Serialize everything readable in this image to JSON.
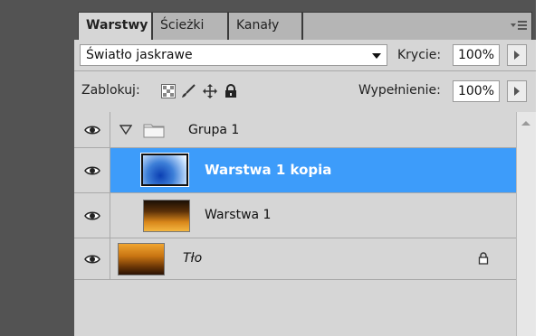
{
  "tabs": [
    {
      "label": "Warstwy",
      "active": true
    },
    {
      "label": "Ścieżki",
      "active": false
    },
    {
      "label": "Kanały",
      "active": false
    }
  ],
  "blend": {
    "mode": "Światło jaskrawe",
    "opacity_label": "Krycie:",
    "opacity_value": "100%"
  },
  "lock": {
    "label": "Zablokuj:",
    "fill_label": "Wypełnienie:",
    "fill_value": "100%"
  },
  "layers": [
    {
      "name": "Grupa 1",
      "type": "group",
      "visible": true,
      "expanded": true
    },
    {
      "name": "Warstwa 1 kopia",
      "type": "layer",
      "visible": true,
      "selected": true,
      "thumb": "blue-gradient"
    },
    {
      "name": "Warstwa 1",
      "type": "layer",
      "visible": true,
      "thumb": "orange-dark-gradient"
    },
    {
      "name": "Tło",
      "type": "background",
      "visible": true,
      "locked": true,
      "thumb": "orange-dark-gradient"
    }
  ],
  "colors": {
    "selection": "#3d9cfa",
    "panel": "#d6d6d6",
    "chrome": "#535353"
  }
}
